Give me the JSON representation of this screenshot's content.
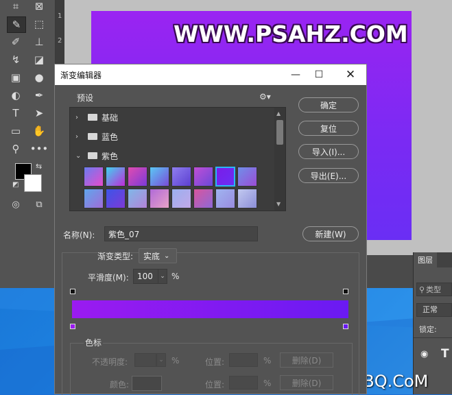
{
  "ruler": {
    "n1": "1",
    "n2": "2"
  },
  "watermark": {
    "text": "WWW.PSAHZ.COM"
  },
  "bottom_watermark": "UiBQ.CoM",
  "layers_panel": {
    "tab": "图层",
    "search_placeholder": "类型",
    "blend_mode": "正常",
    "lock_label": "锁定:"
  },
  "dialog": {
    "title": "渐变编辑器",
    "presets_label": "预设",
    "folders": [
      {
        "name": "基础",
        "expanded": false
      },
      {
        "name": "蓝色",
        "expanded": false
      },
      {
        "name": "紫色",
        "expanded": true
      }
    ],
    "swatches": [
      [
        "#6b7cf0",
        "#e64bcc"
      ],
      [
        "#3fd3f0",
        "#c02bd8"
      ],
      [
        "#e04cb0",
        "#7b3ad8"
      ],
      [
        "#5ac8f5",
        "#7a4bd8"
      ],
      [
        "#8f7ef0",
        "#5b3fd0"
      ],
      [
        "#c04fd6",
        "#6b48d8"
      ],
      [
        "#7a1de8",
        "#6a2ef4"
      ],
      [
        "#6f8fe8",
        "#9b4cd6"
      ],
      [
        "#5fa6ec",
        "#a06cd8"
      ],
      [
        "#3c55e8",
        "#7d39d6"
      ],
      [
        "#7fb8e8",
        "#b483d8"
      ],
      [
        "#b06ad8",
        "#e8a2c8"
      ],
      [
        "#9ab0f0",
        "#c2a8e8"
      ],
      [
        "#d8559e",
        "#8e68d6"
      ],
      [
        "#9fb4f0",
        "#9a8ce0"
      ],
      [
        "#c2c9f0",
        "#8c8ed8"
      ]
    ],
    "selected_swatch": 6,
    "buttons": {
      "ok": "确定",
      "reset": "复位",
      "import": "导入(I)...",
      "export": "导出(E)...",
      "new": "新建(W)"
    },
    "name_label": "名称(N):",
    "name_value": "紫色_07",
    "gradient_type_label": "渐变类型:",
    "gradient_type_value": "实底",
    "smoothness_label": "平滑度(M):",
    "smoothness_value": "100",
    "smoothness_unit": "%",
    "gradient": {
      "start": "#9a1bf0",
      "end": "#6a1af2"
    },
    "stops_section": "色标",
    "opacity_label": "不透明度:",
    "position_label": "位置:",
    "percent": "%",
    "delete_label": "删除(D)",
    "color_label": "颜色:"
  },
  "colors": {
    "foreground": "#000000",
    "background": "#ffffff"
  }
}
